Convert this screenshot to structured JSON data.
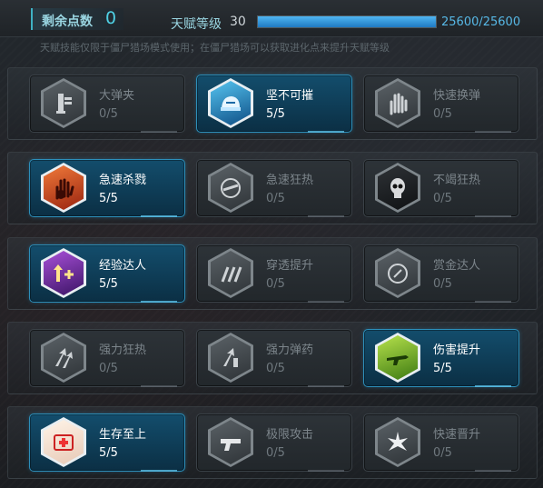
{
  "header": {
    "points_label": "剩余点数",
    "points_value": "0",
    "talent_level_label": "天赋等级",
    "talent_level_value": "30",
    "xp_text": "25600/25600",
    "xp_progress": 1.0
  },
  "notice": "天赋技能仅限于僵尸猎场模式使用；在僵尸猎场可以获取进化点来提升天赋等级",
  "rows": [
    [
      {
        "name": "大弹夹",
        "level": "0/5",
        "active": false,
        "icon": "magazine-icon"
      },
      {
        "name": "坚不可摧",
        "level": "5/5",
        "active": true,
        "icon": "helmet-icon",
        "color": "blue"
      },
      {
        "name": "快速换弹",
        "level": "0/5",
        "active": false,
        "icon": "hand-reload-icon"
      }
    ],
    [
      {
        "name": "急速杀戮",
        "level": "5/5",
        "active": true,
        "icon": "bloody-hand-icon",
        "color": "red"
      },
      {
        "name": "急速狂热",
        "level": "0/5",
        "active": false,
        "icon": "frenzy-gun-icon"
      },
      {
        "name": "不竭狂热",
        "level": "0/5",
        "active": false,
        "icon": "skull-icon",
        "dark": true
      }
    ],
    [
      {
        "name": "经验达人",
        "level": "5/5",
        "active": true,
        "icon": "arrow-plus-icon",
        "color": "purple"
      },
      {
        "name": "穿透提升",
        "level": "0/5",
        "active": false,
        "icon": "penetrate-icon"
      },
      {
        "name": "赏金达人",
        "level": "0/5",
        "active": false,
        "icon": "coin-icon"
      }
    ],
    [
      {
        "name": "强力狂热",
        "level": "0/5",
        "active": false,
        "icon": "double-arrow-icon"
      },
      {
        "name": "强力弹药",
        "level": "0/5",
        "active": false,
        "icon": "ammo-arrow-icon"
      },
      {
        "name": "伤害提升",
        "level": "5/5",
        "active": true,
        "icon": "rifle-icon",
        "color": "green"
      }
    ],
    [
      {
        "name": "生存至上",
        "level": "5/5",
        "active": true,
        "icon": "medical-cross-icon",
        "color": "white"
      },
      {
        "name": "极限攻击",
        "level": "0/5",
        "active": false,
        "icon": "gun-icon"
      },
      {
        "name": "快速晋升",
        "level": "0/5",
        "active": false,
        "icon": "burst-icon"
      }
    ]
  ]
}
